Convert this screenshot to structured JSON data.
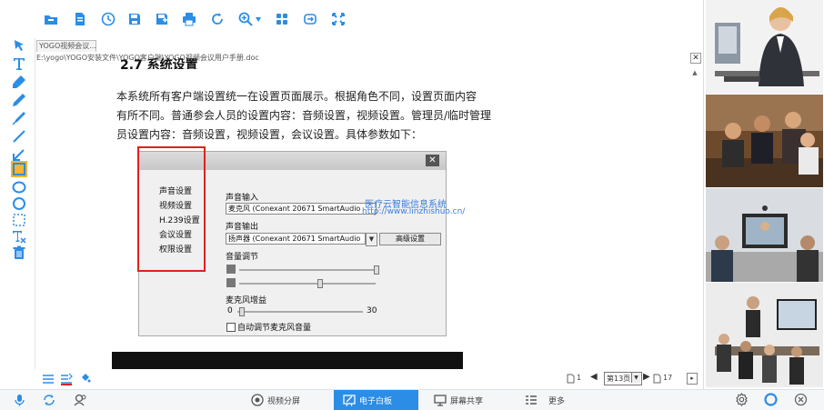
{
  "toolbar": {
    "icons": [
      "folder-open-icon",
      "document-icon",
      "clock-icon",
      "save-icon",
      "save-as-icon",
      "print-icon",
      "refresh-icon",
      "zoom-icon",
      "grid-icon",
      "switch-icon",
      "fullscreen-icon"
    ],
    "accent": "#2b8de6"
  },
  "left_tools": [
    "pointer-icon",
    "text-icon",
    "highlighter-icon",
    "pencil-icon",
    "pen-icon",
    "line-icon",
    "arrow-icon",
    "rectangle-icon",
    "ellipse-icon",
    "circle-icon",
    "selection-icon",
    "clear-text-icon",
    "trash-icon"
  ],
  "document": {
    "tab_label": "YOGO视频会议...",
    "path": "E:\\yogo\\YOGO安装文件\\YOGO客户端\\YOGO视频会议用户手册.doc",
    "section_heading": "2.7 系统设置",
    "paragraph_lines": [
      "本系统所有客户端设置统一在设置页面展示。根据角色不同，设置页面内容",
      "有所不同。普通参会人员的设置内容：音频设置，视频设置。管理员/临时管理",
      "员设置内容：音频设置，视频设置，会议设置。具体参数如下："
    ]
  },
  "dialog": {
    "nav": [
      "声音设置",
      "视频设置",
      "H.239设置",
      "会议设置",
      "权限设置"
    ],
    "mic_label": "声音输入",
    "mic_value": "麦克风 (Conexant 20671 SmartAudio",
    "speaker_label": "声音输出",
    "speaker_value": "扬声器 (Conexant 20671 SmartAudio",
    "advanced_button": "高级设置",
    "volume_label": "音量调节",
    "mic_gain_label": "麦克风增益",
    "gain_min": "0",
    "gain_max": "30",
    "auto_gain_label": "自动调节麦克风音量"
  },
  "watermark": {
    "line1": "医疗云智能信息系统",
    "line2": "http://www.linzhishuo.cn/"
  },
  "pager": {
    "first_page_num": "1",
    "current_page": "第13页",
    "last_page_num": "17"
  },
  "bottom_bar": {
    "video_split": "视频分屏",
    "whiteboard": "电子白板",
    "screen_share": "屏幕共享",
    "more": "更多"
  },
  "videos": [
    "video-feed-1",
    "video-feed-2",
    "video-feed-3",
    "video-feed-4"
  ]
}
